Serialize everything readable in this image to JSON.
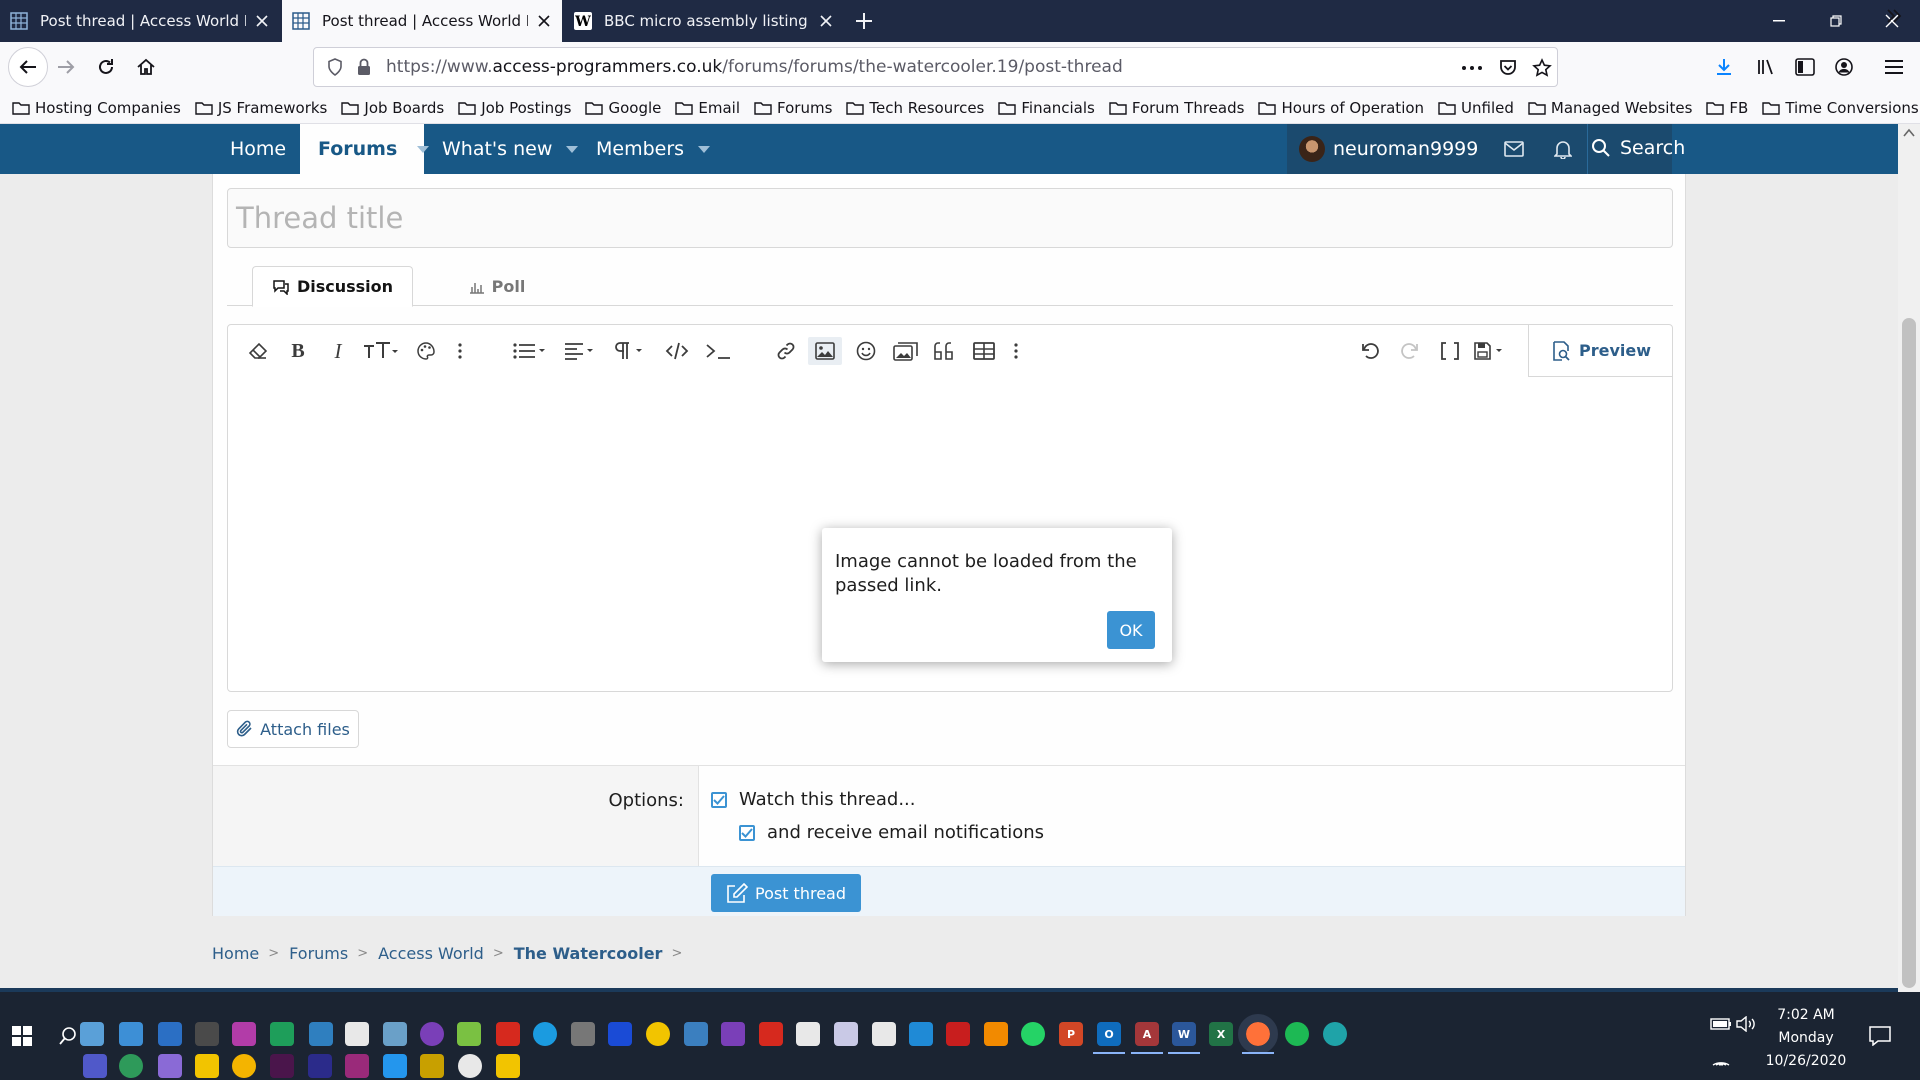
{
  "browser": {
    "tabs": [
      {
        "title": "Post thread | Access World Foru",
        "favicon": "access-world-grid-icon",
        "active": false
      },
      {
        "title": "Post thread | Access World Foru",
        "favicon": "access-world-grid-icon",
        "active": true
      },
      {
        "title": "BBC micro assembly listing - Bl",
        "favicon": "wikipedia-w-icon",
        "active": false
      }
    ],
    "url_prefix": "https://www.",
    "url_domain": "access-programmers.co.uk",
    "url_path": "/forums/forums/the-watercooler.19/post-thread",
    "bookmarks": [
      "Hosting Companies",
      "JS Frameworks",
      "Job Boards",
      "Job Postings",
      "Google",
      "Email",
      "Forums",
      "Tech Resources",
      "Financials",
      "Forum Threads",
      "Hours of Operation",
      "Unfiled",
      "Managed Websites",
      "FB",
      "Time Conversions"
    ]
  },
  "forum_nav": {
    "home": "Home",
    "forums": "Forums",
    "whats_new": "What's new",
    "members": "Members",
    "username": "neuroman9999",
    "search": "Search"
  },
  "form": {
    "title_placeholder": "Thread title",
    "tab_discussion": "Discussion",
    "tab_poll": "Poll",
    "preview": "Preview",
    "attach": "Attach files",
    "options_label": "Options:",
    "watch": "Watch this thread...",
    "email_notify": "and receive email notifications",
    "submit": "Post thread"
  },
  "modal": {
    "message": "Image cannot be loaded from the passed link.",
    "ok": "OK"
  },
  "breadcrumb": [
    "Home",
    "Forums",
    "Access World",
    "The Watercooler"
  ],
  "taskbar": {
    "time": "7:02 AM",
    "day": "Monday",
    "date": "10/26/2020"
  },
  "colors": {
    "forum_nav": "#185886",
    "accent": "#3b93d3",
    "browser_tabstrip": "#1f2a44",
    "taskbar": "#1b2432"
  }
}
